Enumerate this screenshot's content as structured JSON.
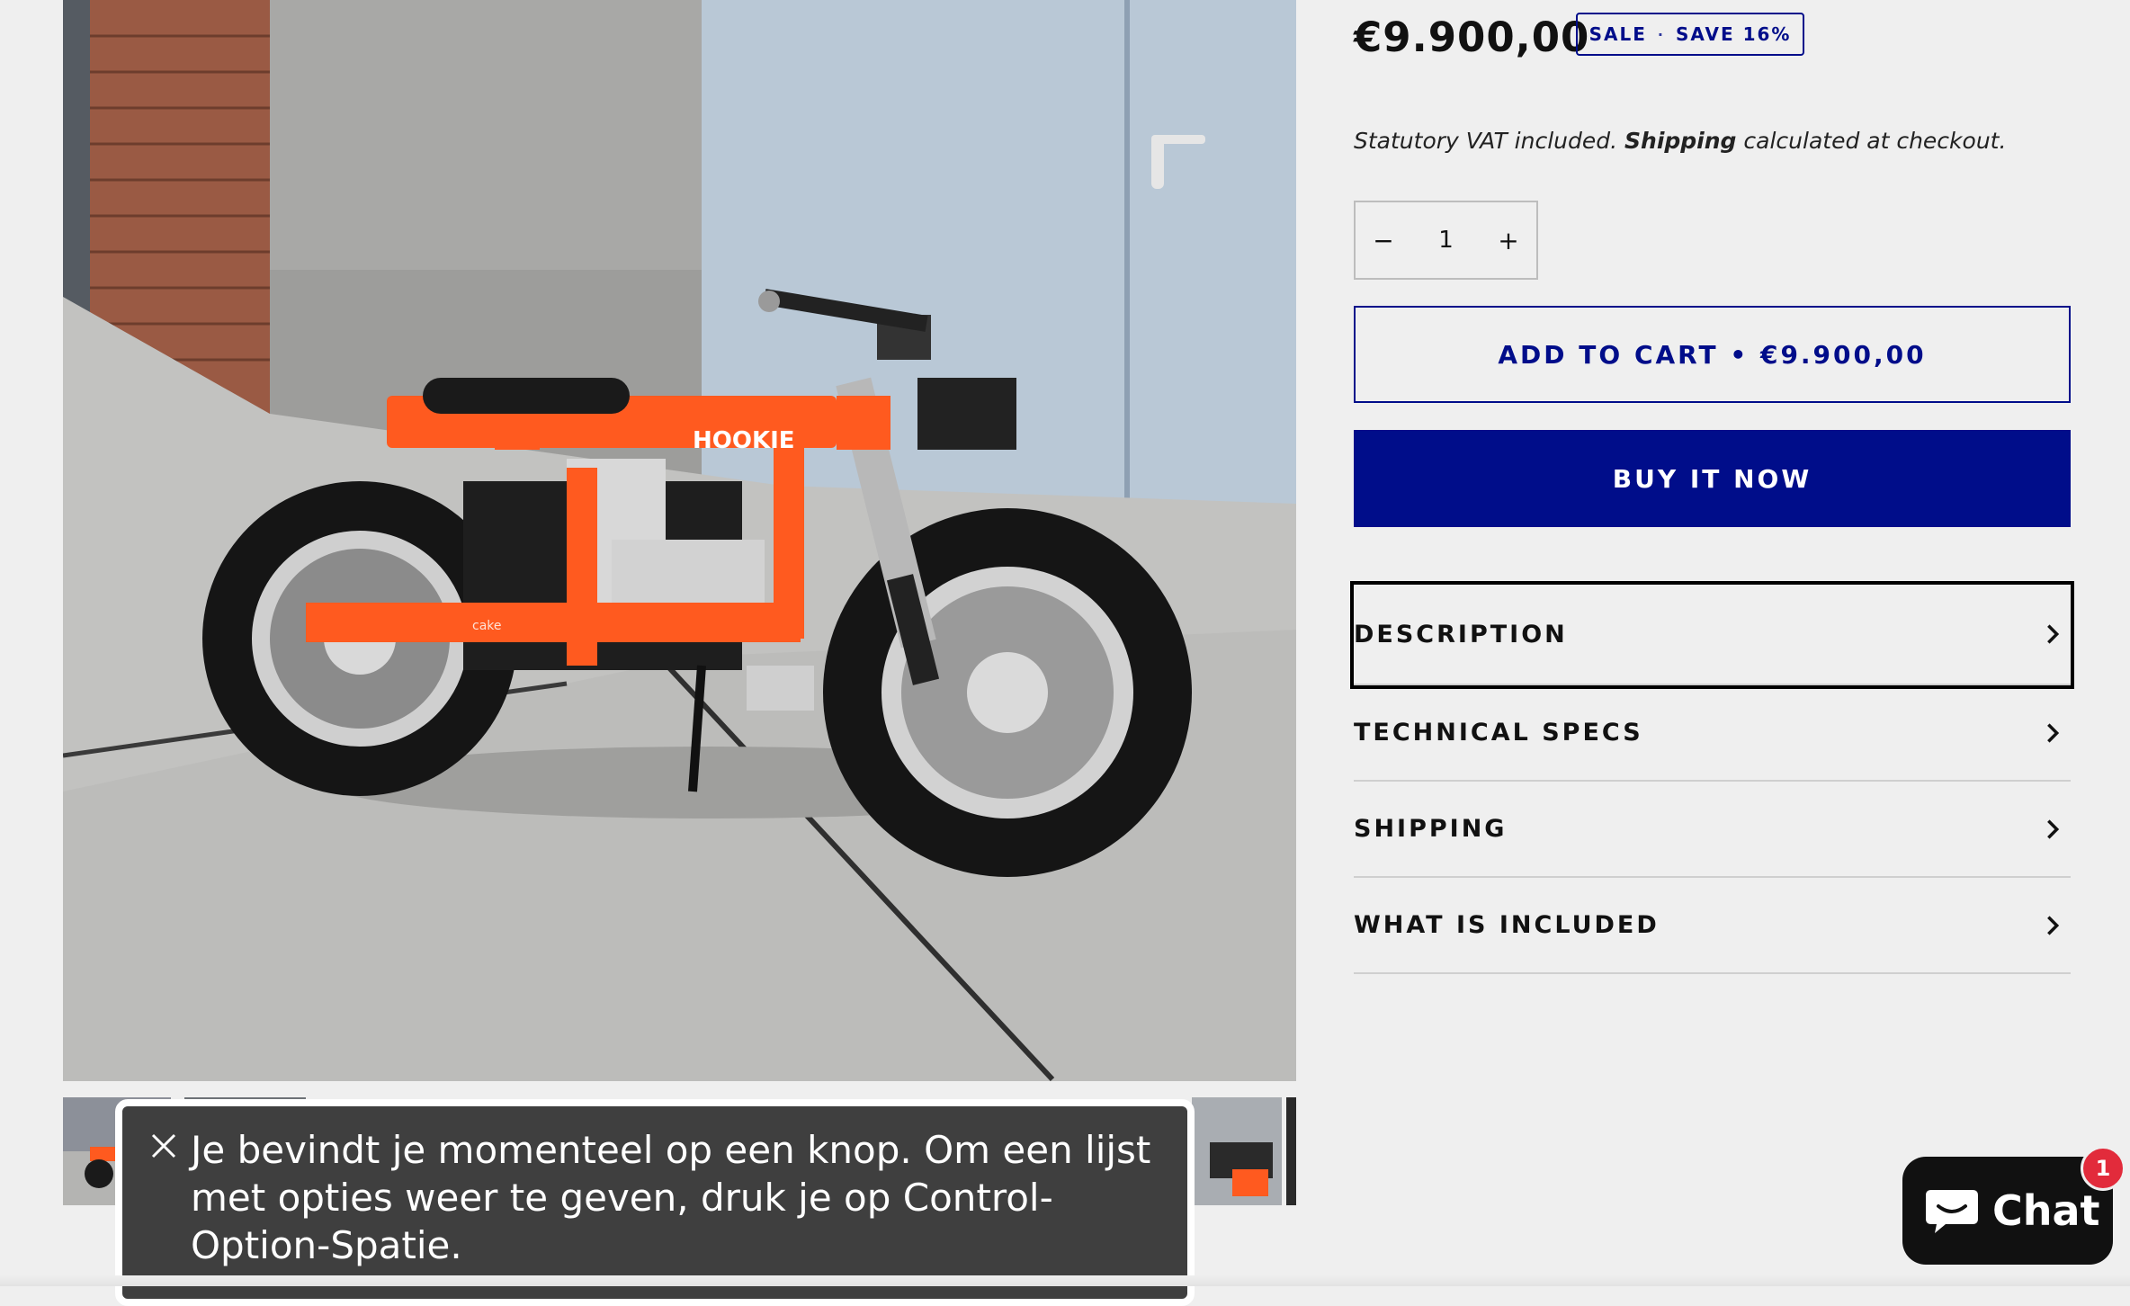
{
  "product": {
    "price": "€9.900,00",
    "badge": {
      "sale": "SALE",
      "separator": "·",
      "save": "SAVE 16%"
    },
    "vat_prefix": "Statutory VAT included.",
    "vat_link": "Shipping",
    "vat_suffix": "calculated at checkout.",
    "frame_text": "HOOKIE",
    "swingarm_text": "cake"
  },
  "quantity": {
    "minus": "−",
    "value": "1",
    "plus": "+"
  },
  "buttons": {
    "add_to_cart": "ADD TO CART • €9.900,00",
    "buy_now": "BUY IT NOW"
  },
  "accordion": [
    {
      "label": "DESCRIPTION",
      "icon": "chevron-right-icon"
    },
    {
      "label": "TECHNICAL SPECS",
      "icon": "chevron-right-icon"
    },
    {
      "label": "SHIPPING",
      "icon": "chevron-right-icon"
    },
    {
      "label": "WHAT IS INCLUDED",
      "icon": "chevron-right-icon"
    }
  ],
  "voiceover": {
    "text": "Je bevindt je momenteel op een knop. Om een lijst met opties weer te geven, druk je op Control-Option-Spatie.",
    "close_icon": "close-icon"
  },
  "chat": {
    "label": "Chat",
    "unread": "1",
    "icon": "chat-bubble-icon"
  },
  "colors": {
    "brand_blue": "#000d8a",
    "background": "#efefef",
    "bike_orange": "#ff5a1f",
    "chat_badge": "#e22b3b"
  }
}
